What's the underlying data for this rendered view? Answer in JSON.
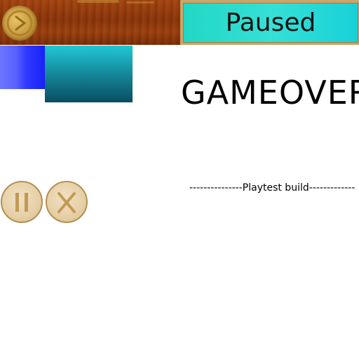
{
  "panel": {
    "paused_label": "Paused"
  },
  "screen": {
    "game_over_label": "GAMEOVER"
  },
  "build": {
    "playtest_label": "---------------Playtest build-------------"
  },
  "icons": {
    "coin": "coin-icon",
    "pause": "pause-icon",
    "close": "close-icon"
  },
  "colors": {
    "wood": "#8a3409",
    "paused_panel": "#22d7c4",
    "blue_swatch": "#2f38ff",
    "teal_swatch": "#15889a",
    "button_face": "#e6cfa6",
    "button_glyph": "#c29a55"
  }
}
